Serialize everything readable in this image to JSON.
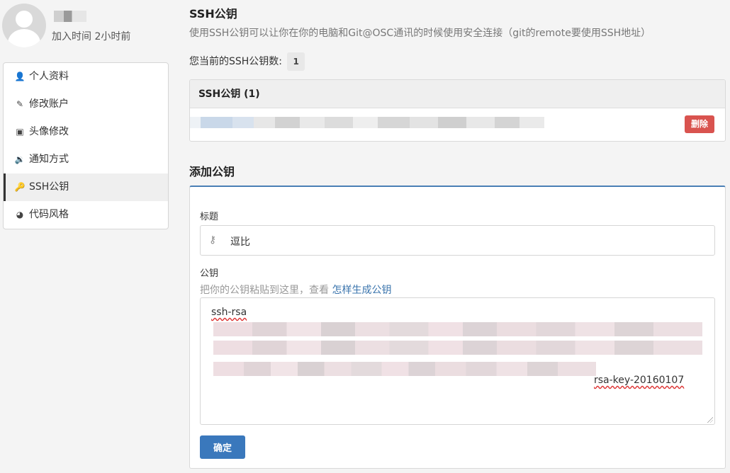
{
  "user": {
    "join_time": "加入时间 2小时前"
  },
  "menu": {
    "items": [
      {
        "label": "个人资料",
        "icon": "user-icon",
        "glyph": "👤"
      },
      {
        "label": "修改账户",
        "icon": "pencil-icon",
        "glyph": "✎"
      },
      {
        "label": "头像修改",
        "icon": "camera-icon",
        "glyph": "▣"
      },
      {
        "label": "通知方式",
        "icon": "speaker-icon",
        "glyph": "🔉"
      },
      {
        "label": "SSH公钥",
        "icon": "key-icon",
        "glyph": "🔑"
      },
      {
        "label": "代码风格",
        "icon": "gauge-icon",
        "glyph": "◕"
      }
    ],
    "active_index": 4
  },
  "ssh": {
    "title": "SSH公钥",
    "description": "使用SSH公钥可以让你在你的电脑和Git@OSC通讯的时候使用安全连接（git的remote要使用SSH地址）",
    "count_label": "您当前的SSH公钥数:",
    "count": "1",
    "panel_title": "SSH公钥 (1)",
    "delete_label": "删除"
  },
  "add": {
    "title": "添加公钥",
    "title_label": "标题",
    "title_value": "逗比",
    "key_label": "公钥",
    "key_hint": "把你的公钥粘贴到这里，查看",
    "key_hint_link": "怎样生成公钥",
    "key_line1": "ssh-rsa",
    "key_tail": "rsa-key-20160107",
    "submit_label": "确定"
  },
  "colors": {
    "primary": "#3a78bc",
    "danger": "#d9534f",
    "link": "#3a74ad",
    "panel_accent": "#4a7fb5"
  }
}
